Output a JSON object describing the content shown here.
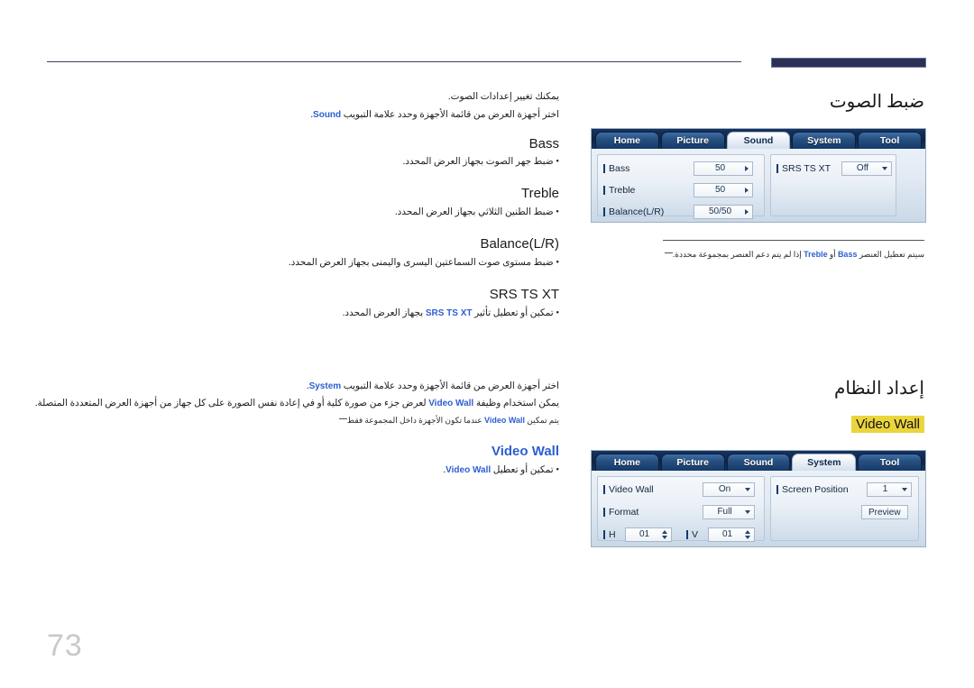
{
  "page": {
    "number": "73"
  },
  "sound_section": {
    "title": "ضبط الصوت",
    "intro_line1": "يمكنك تغيير إعدادات الصوت.",
    "intro_line2_pre": "اختر أجهزة العرض من قائمة الأجهزة وحدد علامة التبويب ",
    "intro_line2_term": "Sound",
    "intro_line2_post": ".",
    "items": [
      {
        "heading": "Bass",
        "desc": "• ضبط جهر الصوت بجهاز العرض المحدد."
      },
      {
        "heading": "Treble",
        "desc": "• ضبط الطنين الثلاثي بجهاز العرض المحدد."
      },
      {
        "heading": "Balance(L/R)",
        "desc": "• ضبط مستوى صوت السماعتين اليسرى واليمنى بجهاز العرض المحدد."
      }
    ],
    "srs_heading": "SRS TS XT",
    "srs_desc_pre": "• تمكين أو تعطيل تأثير ",
    "srs_desc_term": "SRS TS XT",
    "srs_desc_post": " بجهاز العرض المحدد.",
    "note_pre": "سيتم تعطيل العنصر ",
    "note_term1": "Bass",
    "note_mid": " أو ",
    "note_term2": "Treble",
    "note_post": " إذا لم يتم دعم العنصر بمجموعة محددة."
  },
  "system_section": {
    "title": "إعداد النظام",
    "highlight_label": "Video Wall",
    "intro_pre": "اختر أجهزة العرض من قائمة الأجهزة وحدد علامة التبويب ",
    "intro_term": "System",
    "intro_post": ".",
    "desc_pre": "يمكن استخدام وظيفة ",
    "desc_term": "Video Wall",
    "desc_post": " لعرض جزء من صورة كلية أو في إعادة نفس الصورة على كل جهاز من أجهزة العرض المتعددة المتصلة.",
    "note_pre": "يتم تمكين ",
    "note_term": "Video Wall",
    "note_post": " عندما تكون الأجهزة داخل المجموعة فقط",
    "item_heading": "Video Wall",
    "item_desc_pre": "• تمكين أو تعطيل ",
    "item_desc_term": "Video Wall",
    "item_desc_post": "."
  },
  "sound_osd": {
    "tabs": [
      {
        "label": "Home",
        "active": false
      },
      {
        "label": "Picture",
        "active": false
      },
      {
        "label": "Sound",
        "active": true
      },
      {
        "label": "System",
        "active": false
      },
      {
        "label": "Tool",
        "active": false
      }
    ],
    "left_rows": [
      {
        "label": "Bass",
        "value": "50",
        "control": "arrow-right"
      },
      {
        "label": "Treble",
        "value": "50",
        "control": "arrow-right"
      },
      {
        "label": "Balance(L/R)",
        "value": "50/50",
        "control": "arrow-right"
      }
    ],
    "right_rows": [
      {
        "label": "SRS TS XT",
        "value": "Off",
        "control": "arrow-down"
      }
    ]
  },
  "videowall_osd": {
    "tabs": [
      {
        "label": "Home",
        "active": false
      },
      {
        "label": "Picture",
        "active": false
      },
      {
        "label": "Sound",
        "active": false
      },
      {
        "label": "System",
        "active": true
      },
      {
        "label": "Tool",
        "active": false
      }
    ],
    "left_rows": [
      {
        "label": "Video Wall",
        "value": "On",
        "control": "arrow-down"
      },
      {
        "label": "Format",
        "value": "Full",
        "control": "arrow-down"
      }
    ],
    "hv_rows": [
      {
        "label": "H",
        "value": "01"
      },
      {
        "label": "V",
        "value": "01"
      }
    ],
    "right_rows": [
      {
        "label": "Screen Position",
        "value": "1",
        "control": "arrow-down"
      }
    ],
    "preview_button": "Preview"
  },
  "colors": {
    "accent_blue": "#2d5fd0",
    "header_block": "#2b3054",
    "highlight_yellow": "#ebd53d",
    "osd_tab_active": "#e7eef6"
  }
}
